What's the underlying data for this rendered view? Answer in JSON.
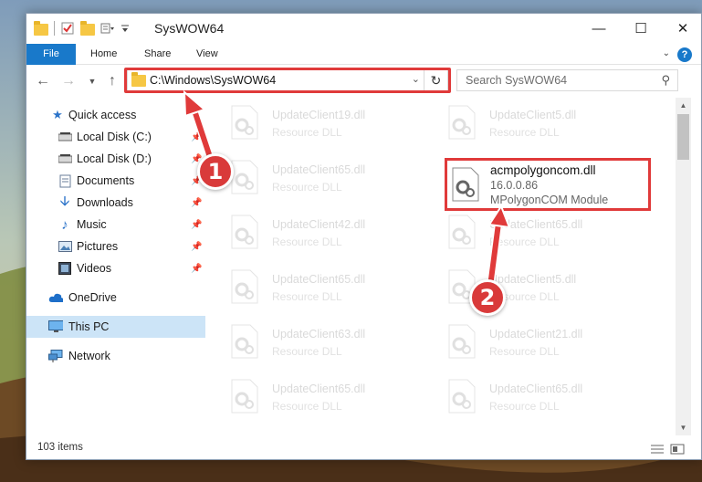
{
  "window": {
    "title": "SysWOW64",
    "minimize_glyph": "—",
    "maximize_glyph": "☐",
    "close_glyph": "✕"
  },
  "ribbon": {
    "tabs": [
      {
        "label": "File"
      },
      {
        "label": "Home"
      },
      {
        "label": "Share"
      },
      {
        "label": "View"
      }
    ],
    "help_glyph": "?"
  },
  "address": {
    "path": "C:\\Windows\\SysWOW64",
    "search_placeholder": "Search SysWOW64"
  },
  "sidebar": {
    "items": [
      {
        "label": "Quick access",
        "icon": "star-icon",
        "pinned": false
      },
      {
        "label": "Local Disk (C:)",
        "icon": "drive-icon",
        "pinned": true
      },
      {
        "label": "Local Disk (D:)",
        "icon": "drive-icon",
        "pinned": true
      },
      {
        "label": "Documents",
        "icon": "documents-icon",
        "pinned": true
      },
      {
        "label": "Downloads",
        "icon": "download-icon",
        "pinned": true
      },
      {
        "label": "Music",
        "icon": "music-icon",
        "pinned": true
      },
      {
        "label": "Pictures",
        "icon": "pictures-icon",
        "pinned": true
      },
      {
        "label": "Videos",
        "icon": "videos-icon",
        "pinned": true
      },
      {
        "label": "OneDrive",
        "icon": "cloud-icon",
        "pinned": false
      },
      {
        "label": "This PC",
        "icon": "computer-icon",
        "pinned": false,
        "selected": true
      },
      {
        "label": "Network",
        "icon": "network-icon",
        "pinned": false
      }
    ]
  },
  "files": {
    "left_column": [
      {
        "name": "UpdateClient19.dll",
        "desc": "Resource DLL"
      },
      {
        "name": "UpdateClient65.dll",
        "desc": "Resource DLL"
      },
      {
        "name": "UpdateClient42.dll",
        "desc": "Resource DLL"
      },
      {
        "name": "UpdateClient65.dll",
        "desc": "Resource DLL"
      },
      {
        "name": "UpdateClient63.dll",
        "desc": "Resource DLL"
      },
      {
        "name": "UpdateClient65.dll",
        "desc": "Resource DLL"
      }
    ],
    "right_column": [
      {
        "name": "UpdateClient5.dll",
        "desc": "Resource DLL"
      },
      {
        "name": "UpdateClient65.dll",
        "desc": "Resource DLL"
      },
      {
        "name": "UpdateClient5.dll",
        "desc": "Resource DLL"
      },
      {
        "name": "UpdateClient21.dll",
        "desc": "Resource DLL"
      },
      {
        "name": "UpdateClient65.dll",
        "desc": "Resource DLL"
      }
    ],
    "highlighted": {
      "name": "acmpolygoncom.dll",
      "version": "16.0.0.86",
      "description": "MPolygonCOM Module"
    }
  },
  "status": {
    "item_count": "103 items"
  },
  "annotations": {
    "step1": "1",
    "step2": "2",
    "color": "#e03a3a"
  }
}
